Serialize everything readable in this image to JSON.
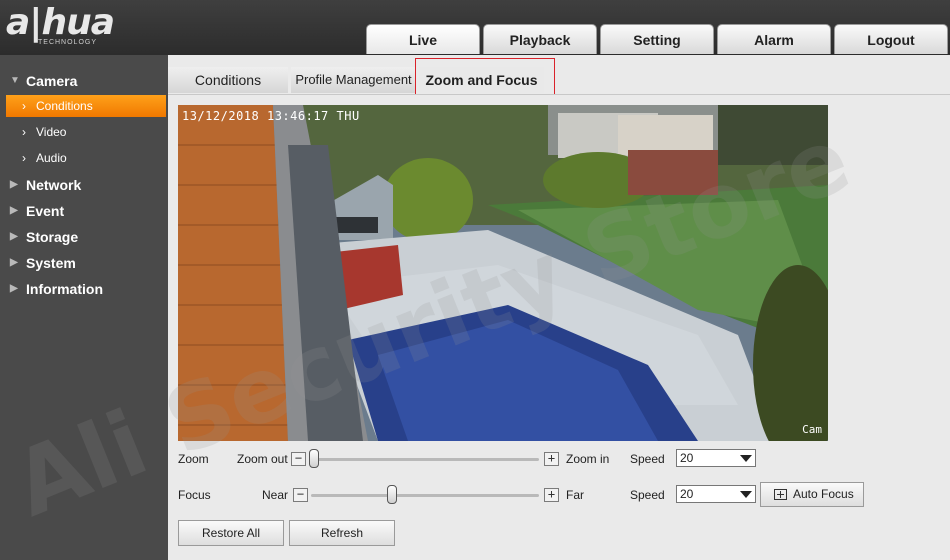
{
  "brand": {
    "name": "a|hua",
    "sub": "TECHNOLOGY"
  },
  "main_tabs": [
    {
      "label": "Live",
      "active": true
    },
    {
      "label": "Playback"
    },
    {
      "label": "Setting"
    },
    {
      "label": "Alarm"
    },
    {
      "label": "Logout"
    }
  ],
  "sidebar": {
    "groups": [
      {
        "label": "Camera",
        "expanded": true
      },
      {
        "label": "Network"
      },
      {
        "label": "Event"
      },
      {
        "label": "Storage"
      },
      {
        "label": "System"
      },
      {
        "label": "Information"
      }
    ],
    "camera_items": [
      {
        "label": "Conditions",
        "active": true
      },
      {
        "label": "Video"
      },
      {
        "label": "Audio"
      }
    ]
  },
  "sub_tabs": [
    {
      "label": "Conditions"
    },
    {
      "label": "Profile Management"
    },
    {
      "label": "Zoom and Focus",
      "active": true
    }
  ],
  "video": {
    "osd_time": "13/12/2018 13:46:17 THU",
    "osd_name": "Cam"
  },
  "zoom": {
    "label": "Zoom",
    "min_label": "Zoom out",
    "max_label": "Zoom in",
    "minus": "−",
    "plus": "+",
    "position": 0.0,
    "speed_label": "Speed",
    "speed_value": "20"
  },
  "focus": {
    "label": "Focus",
    "min_label": "Near",
    "max_label": "Far",
    "minus": "−",
    "plus": "+",
    "position": 0.35,
    "speed_label": "Speed",
    "speed_value": "20",
    "auto_focus_label": "Auto Focus"
  },
  "buttons": {
    "restore_all": "Restore All",
    "refresh": "Refresh"
  },
  "watermark": {
    "text": "Ali Security Store"
  },
  "colors": {
    "accent_orange": "#f58a0a",
    "highlight_red": "#d9222a",
    "sidebar_bg": "#4a4a4a",
    "content_bg": "#eaeaea"
  }
}
